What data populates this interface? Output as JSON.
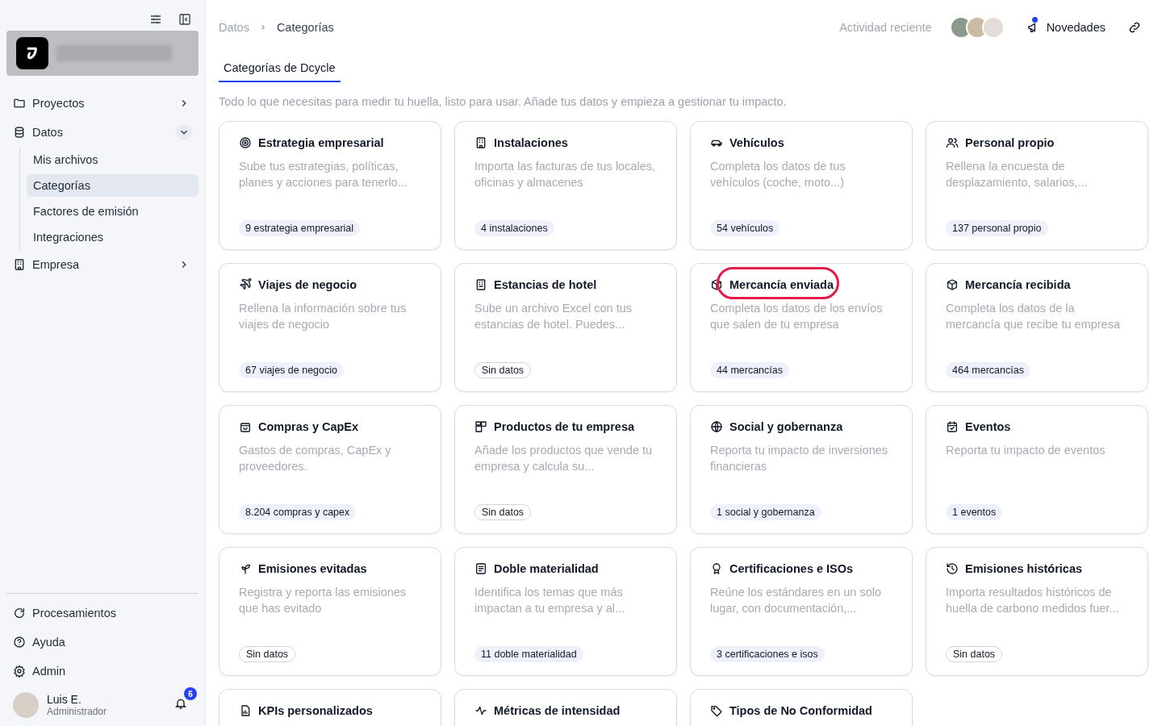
{
  "sidebar": {
    "nav": [
      {
        "label": "Proyectos",
        "expanded": false
      },
      {
        "label": "Datos",
        "expanded": true,
        "children": [
          {
            "label": "Mis archivos",
            "selected": false
          },
          {
            "label": "Categorías",
            "selected": true
          },
          {
            "label": "Factores de emisión",
            "selected": false
          },
          {
            "label": "Integraciones",
            "selected": false
          }
        ]
      },
      {
        "label": "Empresa",
        "expanded": false
      }
    ],
    "footer": [
      {
        "label": "Procesamientos"
      },
      {
        "label": "Ayuda"
      },
      {
        "label": "Admin"
      }
    ],
    "user": {
      "name": "Luis E.",
      "role": "Administrador",
      "notifications": "6"
    }
  },
  "breadcrumb": [
    "Datos",
    "Categorías"
  ],
  "header": {
    "activity": "Actividad reciente",
    "news": "Novedades",
    "news_unread": true
  },
  "tabs": [
    {
      "label": "Categorías de Dcycle",
      "selected": true
    }
  ],
  "subtitle": "Todo lo que necesitas para medir tu huella, listo para usar. Añade tus datos y empieza a gestionar tu impacto.",
  "cards": [
    {
      "title": "Estrategia empresarial",
      "description": "Sube tus estrategias, políticas, planes y acciones para tenerlo...",
      "badge": "9 estrategia empresarial",
      "kind": "count",
      "highlighted": false
    },
    {
      "title": "Instalaciones",
      "description": "Importa las facturas de tus locales, oficinas y almacenes",
      "badge": "4 instalaciones",
      "kind": "count",
      "highlighted": false
    },
    {
      "title": "Vehículos",
      "description": "Completa los datos de tus vehículos (coche, moto...)",
      "badge": "54 vehículos",
      "kind": "count",
      "highlighted": false
    },
    {
      "title": "Personal propio",
      "description": "Rellena la encuesta de desplazamiento, salarios,...",
      "badge": "137 personal propio",
      "kind": "count",
      "highlighted": false
    },
    {
      "title": "Viajes de negocio",
      "description": "Rellena la información sobre tus viajes de negocio",
      "badge": "67 viajes de negocio",
      "kind": "count",
      "highlighted": false
    },
    {
      "title": "Estancias de hotel",
      "description": "Sube un archivo Excel con tus estancias de hotel. Puedes...",
      "badge": "Sin datos",
      "kind": "empty",
      "highlighted": false
    },
    {
      "title": "Mercancía enviada",
      "description": "Completa los datos de los envíos que salen de tu empresa",
      "badge": "44 mercancías",
      "kind": "count",
      "highlighted": true
    },
    {
      "title": "Mercancía recibida",
      "description": "Completa los datos de la mercancía que recibe tu empresa",
      "badge": "464 mercancías",
      "kind": "count",
      "highlighted": false
    },
    {
      "title": "Compras y CapEx",
      "description": "Gastos de compras, CapEx y proveedores.",
      "badge": "8.204 compras y capex",
      "kind": "count",
      "highlighted": false
    },
    {
      "title": "Productos de tu empresa",
      "description": "Añade los productos que vende tu empresa y calcula su...",
      "badge": "Sin datos",
      "kind": "empty",
      "highlighted": false
    },
    {
      "title": "Social y gobernanza",
      "description": "Reporta tu impacto de inversiones financieras",
      "badge": "1 social y gobernanza",
      "kind": "count",
      "highlighted": false
    },
    {
      "title": "Eventos",
      "description": "Reporta tu impacto de eventos",
      "badge": "1 eventos",
      "kind": "count",
      "highlighted": false
    },
    {
      "title": "Emisiones evitadas",
      "description": "Registra y reporta las emisiones que has evitado",
      "badge": "Sin datos",
      "kind": "empty",
      "highlighted": false
    },
    {
      "title": "Doble materialidad",
      "description": "Identifica los temas que más impactan a tu empresa y al...",
      "badge": "11 doble materialidad",
      "kind": "count",
      "highlighted": false
    },
    {
      "title": "Certificaciones e ISOs",
      "description": "Reúne los estándares en un solo lugar, con documentación,...",
      "badge": "3 certificaciones e isos",
      "kind": "count",
      "highlighted": false
    },
    {
      "title": "Emisiones históricas",
      "description": "Importa resultados históricos de huella de carbono medidos fuer...",
      "badge": "Sin datos",
      "kind": "empty",
      "highlighted": false
    },
    {
      "title": "KPIs personalizados"
    },
    {
      "title": "Métricas de intensidad"
    },
    {
      "title": "Tipos de No Conformidad"
    }
  ]
}
